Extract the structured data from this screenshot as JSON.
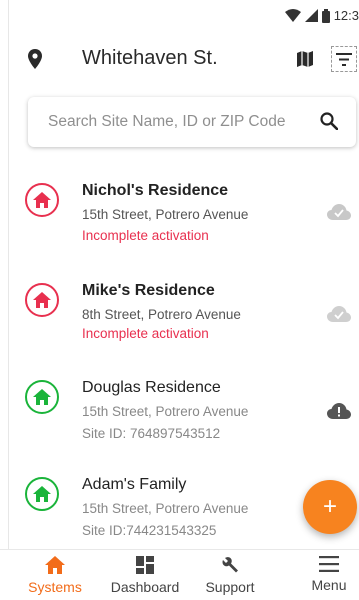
{
  "status_bar": {
    "time": "12:3"
  },
  "header": {
    "title": "Whitehaven St."
  },
  "search": {
    "placeholder": "Search Site Name, ID or ZIP Code"
  },
  "colors": {
    "accent": "#f26c1a",
    "error": "#e8304f",
    "ok": "#1ab43a",
    "fab": "#f7831f"
  },
  "sites": [
    {
      "name": "Nichol's Residence",
      "address": "15th Street, Potrero Avenue",
      "status": "Incomplete activation",
      "cloud": "cloud-check-icon"
    },
    {
      "name": "Mike's Residence",
      "address": "8th Street, Potrero Avenue",
      "status": "Incomplete activation",
      "cloud": "cloud-check-icon"
    },
    {
      "name": "Douglas Residence",
      "address": "15th Street, Potrero Avenue",
      "site_id": "Site ID: 764897543512",
      "cloud": "cloud-alert-icon"
    },
    {
      "name": "Adam's Family",
      "address": "15th Street, Potrero Avenue",
      "site_id": "Site ID:744231543325"
    }
  ],
  "bottom_nav": {
    "items": [
      {
        "label": "Systems",
        "icon": "home-icon",
        "active": true
      },
      {
        "label": "Dashboard",
        "icon": "dashboard-icon"
      },
      {
        "label": "Support",
        "icon": "wrench-icon"
      },
      {
        "label": "Menu",
        "icon": "menu-icon"
      }
    ]
  },
  "fab": {
    "label": "+"
  }
}
